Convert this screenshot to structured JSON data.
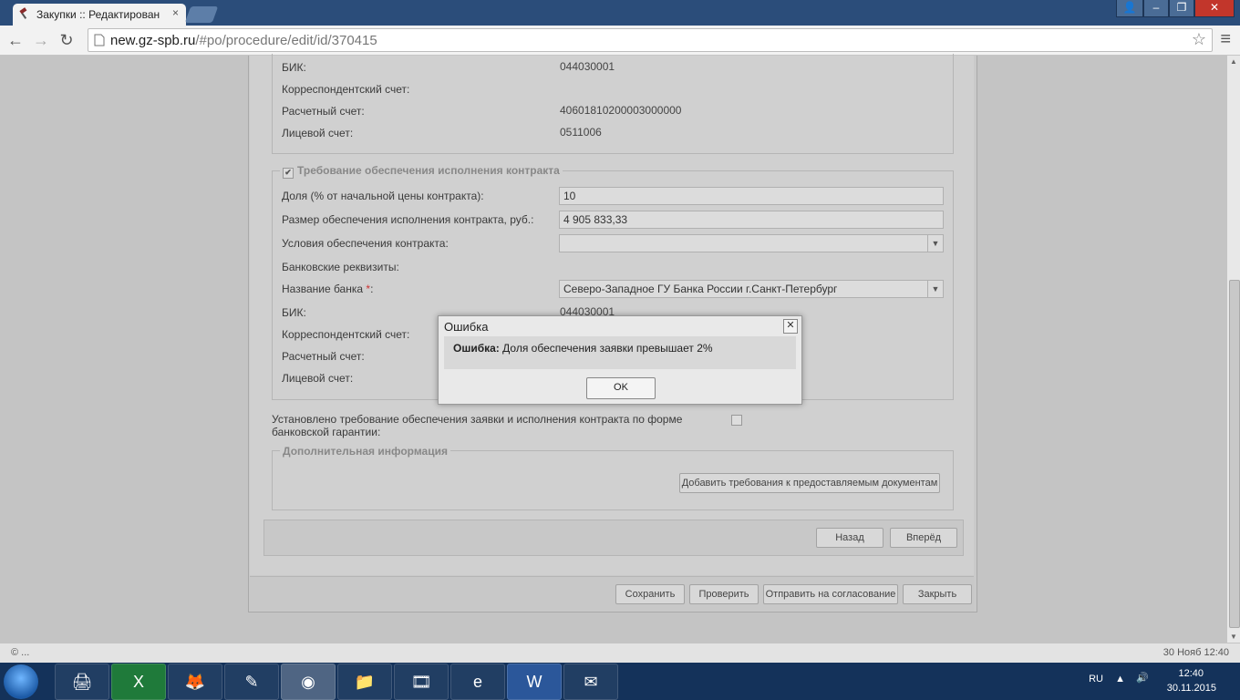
{
  "browser": {
    "tab_title": "Закупки :: Редактирован",
    "url_host": "new.gz-spb.ru",
    "url_path": "/#po/procedure/edit/id/370415"
  },
  "top_section": {
    "bik_label": "БИК:",
    "bik_value": "044030001",
    "corr_label": "Корреспондентский счет:",
    "settle_label": "Расчетный счет:",
    "settle_value": "40601810200003000000",
    "personal_label": "Лицевой счет:",
    "personal_value": "0511006"
  },
  "contract_security": {
    "legend": "Требование обеспечения исполнения контракта",
    "share_label": "Доля (% от начальной цены контракта):",
    "share_value": "10",
    "size_label": "Размер обеспечения исполнения контракта, руб.:",
    "size_value": "4 905 833,33",
    "conditions_label": "Условия обеспечения контракта:",
    "conditions_value": "",
    "bank_req_label": "Банковские реквизиты:",
    "bank_name_label": "Название банка",
    "bank_name_req": "*",
    "bank_name_colon": ":",
    "bank_name_value": "Северо-Западное ГУ Банка России г.Санкт-Петербург",
    "bik_label": "БИК:",
    "bik_value": "044030001",
    "corr_label": "Корреспондентский счет:",
    "settle_label": "Расчетный счет:",
    "personal_label": "Лицевой счет:"
  },
  "guarantee": {
    "label_line1": "Установлено требование обеспечения заявки и исполнения контракта по форме",
    "label_line2": "банковской гарантии:"
  },
  "additional": {
    "legend": "Дополнительная информация",
    "add_docs_button": "Добавить требования к предоставляемым документам"
  },
  "nav": {
    "back": "Назад",
    "forward": "Вперёд"
  },
  "actions": {
    "save": "Сохранить",
    "check": "Проверить",
    "send": "Отправить на согласование",
    "close": "Закрыть"
  },
  "dialog": {
    "title": "Ошибка",
    "msg_bold": "Ошибка:",
    "msg_text": " Доля обеспечения заявки превышает 2%",
    "ok": "OK"
  },
  "status": {
    "left": "© ...",
    "right": "30 Нояб 12:40"
  },
  "taskbar": {
    "lang": "RU",
    "time": "12:40",
    "date": "30.11.2015"
  }
}
